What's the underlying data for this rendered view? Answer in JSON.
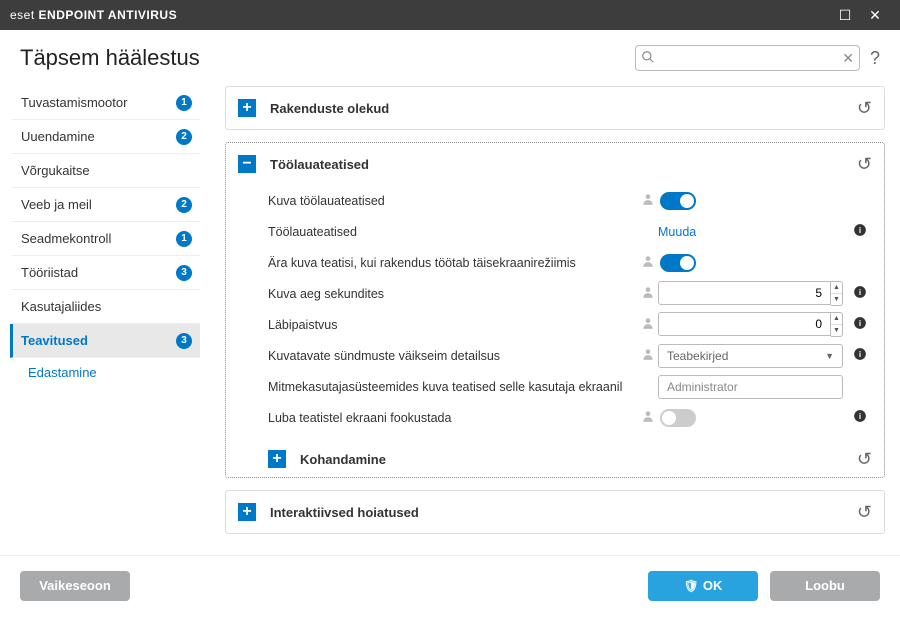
{
  "titlebar": {
    "brand1": "eset",
    "brand2": "ENDPOINT ANTIVIRUS"
  },
  "header": {
    "title": "Täpsem häälestus",
    "search_placeholder": ""
  },
  "sidebar": {
    "items": [
      {
        "label": "Tuvastamismootor",
        "badge": "1"
      },
      {
        "label": "Uuendamine",
        "badge": "2"
      },
      {
        "label": "Võrgukaitse",
        "badge": ""
      },
      {
        "label": "Veeb ja meil",
        "badge": "2"
      },
      {
        "label": "Seadmekontroll",
        "badge": "1"
      },
      {
        "label": "Tööriistad",
        "badge": "3"
      },
      {
        "label": "Kasutajaliides",
        "badge": ""
      },
      {
        "label": "Teavitused",
        "badge": "3"
      }
    ],
    "sub": {
      "label": "Edastamine"
    }
  },
  "sections": {
    "app_states": {
      "title": "Rakenduste olekud"
    },
    "desktop": {
      "title": "Töölauateatised",
      "rows": {
        "show": "Kuva töölauateatised",
        "notifications": "Töölauateatised",
        "notifications_action": "Muuda",
        "fullscreen": "Ära kuva teatisi, kui rakendus töötab täisekraanirežiimis",
        "duration": "Kuva aeg sekundites",
        "duration_value": "5",
        "opacity": "Läbipaistvus",
        "opacity_value": "0",
        "verbosity": "Kuvatavate sündmuste väikseim detailsus",
        "verbosity_value": "Teabekirjed",
        "multiuser": "Mitmekasutajasüsteemides kuva teatised selle kasutaja ekraanil",
        "multiuser_value": "Administrator",
        "focus": "Luba teatistel ekraani fookustada"
      },
      "customize": {
        "title": "Kohandamine"
      }
    },
    "interactive": {
      "title": "Interaktiivsed hoiatused"
    }
  },
  "footer": {
    "defaults": "Vaikeseoon",
    "ok": "OK",
    "cancel": "Loobu"
  }
}
